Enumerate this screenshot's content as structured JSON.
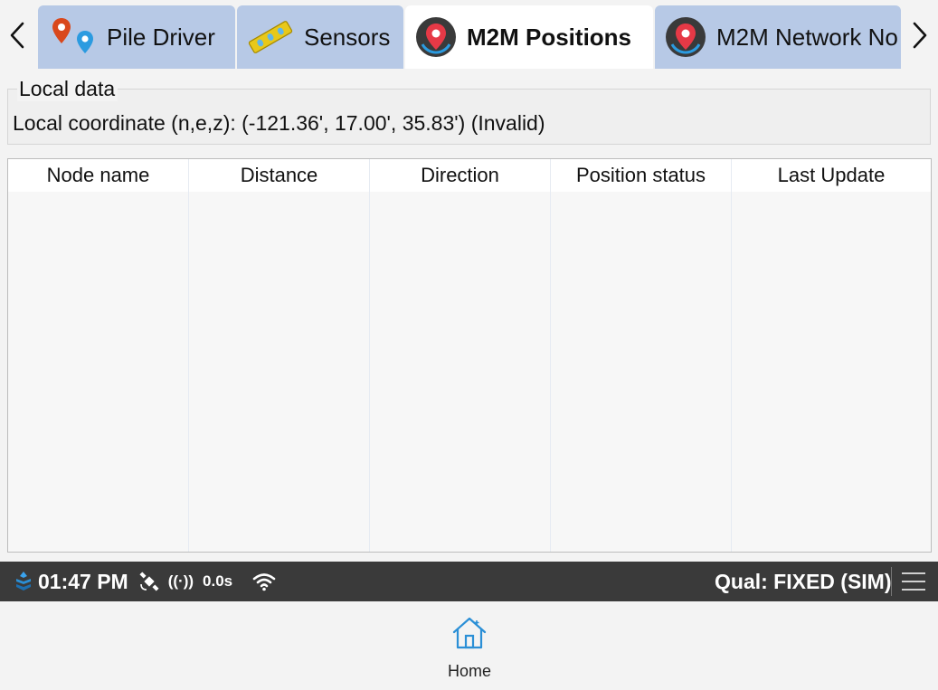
{
  "tabs": [
    {
      "label": "Pile Driver",
      "icon": "map-pins-icon",
      "active": false
    },
    {
      "label": "Sensors",
      "icon": "level-icon",
      "active": false
    },
    {
      "label": "M2M Positions",
      "icon": "location-pin-icon",
      "active": true
    },
    {
      "label": "M2M Network No",
      "icon": "location-pin-icon",
      "active": false
    }
  ],
  "local_data": {
    "title": "Local data",
    "coordinate_text": "Local coordinate (n,e,z): (-121.36', 17.00', 35.83') (Invalid)"
  },
  "table": {
    "columns": [
      "Node name",
      "Distance",
      "Direction",
      "Position status",
      "Last Update"
    ],
    "rows": []
  },
  "status_bar": {
    "time": "01:47 PM",
    "radio": "((·))",
    "latency": "0.0s",
    "quality": "Qual: FIXED (SIM)"
  },
  "bottom_nav": {
    "home_label": "Home"
  },
  "colors": {
    "tab_inactive": "#b7c9e6",
    "tab_active": "#ffffff",
    "status_bar": "#3a3a3a",
    "accent_blue": "#2b8fd6",
    "pin_red": "#e63946"
  }
}
